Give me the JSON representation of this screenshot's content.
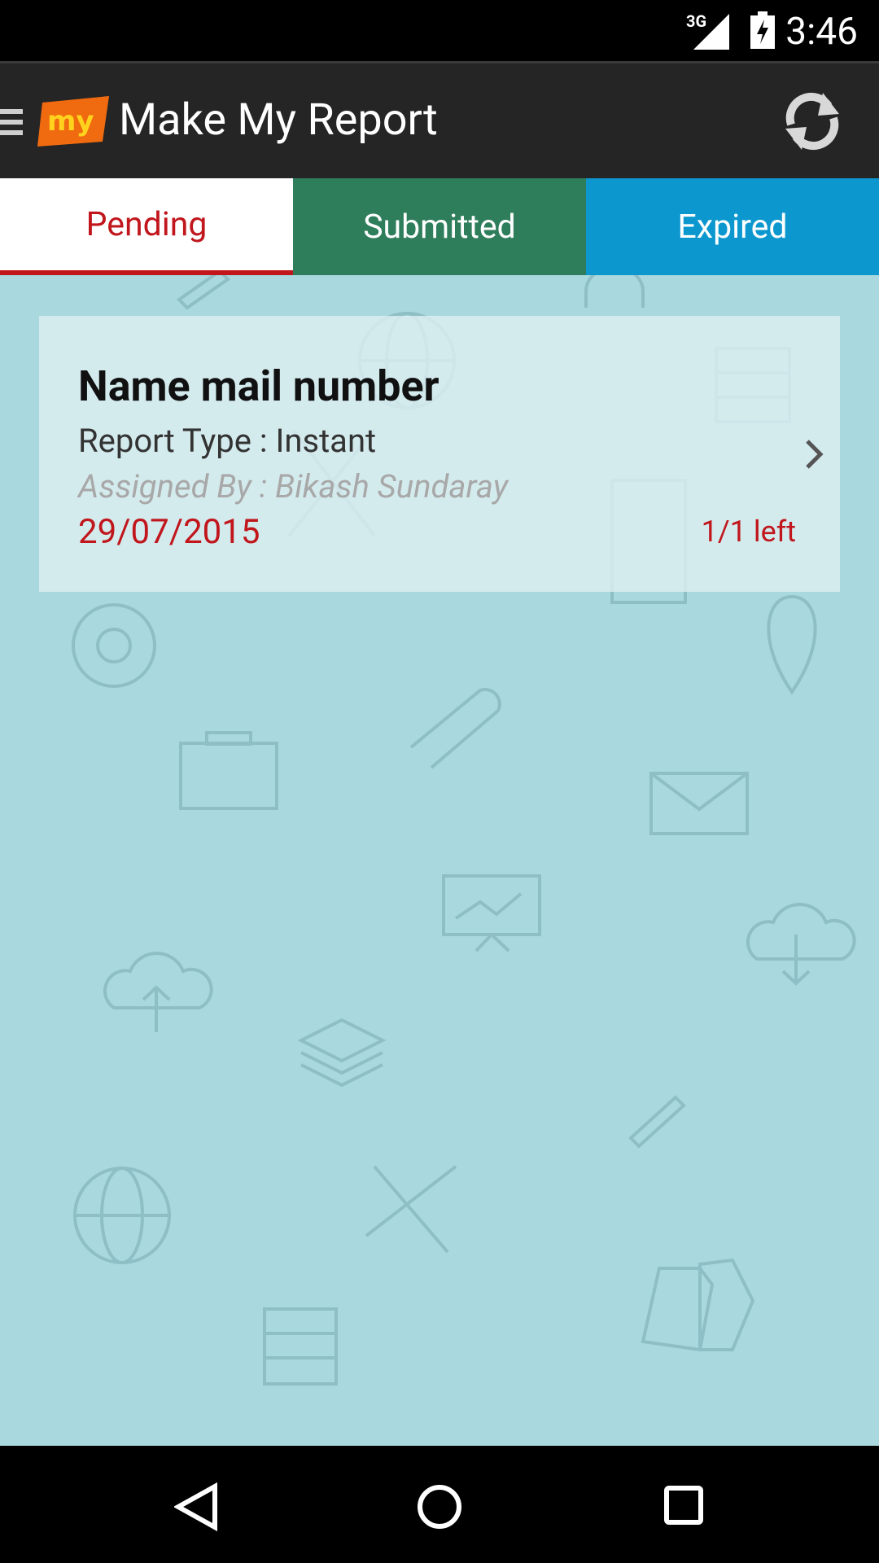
{
  "status_bar": {
    "network": "3G",
    "time": "3:46"
  },
  "app_bar": {
    "logo_text": "my",
    "title": "Make My Report"
  },
  "tabs": [
    {
      "label": "Pending",
      "selected": true,
      "color": "#ffffff"
    },
    {
      "label": "Submitted",
      "selected": false,
      "color": "#2e7d5b"
    },
    {
      "label": "Expired",
      "selected": false,
      "color": "#0c98cf"
    }
  ],
  "report_card": {
    "title": "Name mail number",
    "report_type": "Report Type : Instant",
    "assigned_by": "Assigned By : Bikash Sundaray",
    "date": "29/07/2015",
    "remaining": "1/1 left"
  },
  "colors": {
    "accent_red": "#c0161c",
    "app_bar": "#252525",
    "content_background": "#a9d8de"
  },
  "icons": [
    "menu-icon",
    "refresh-icon",
    "chevron-right-icon",
    "back-icon",
    "home-icon",
    "recent-apps-icon"
  ]
}
